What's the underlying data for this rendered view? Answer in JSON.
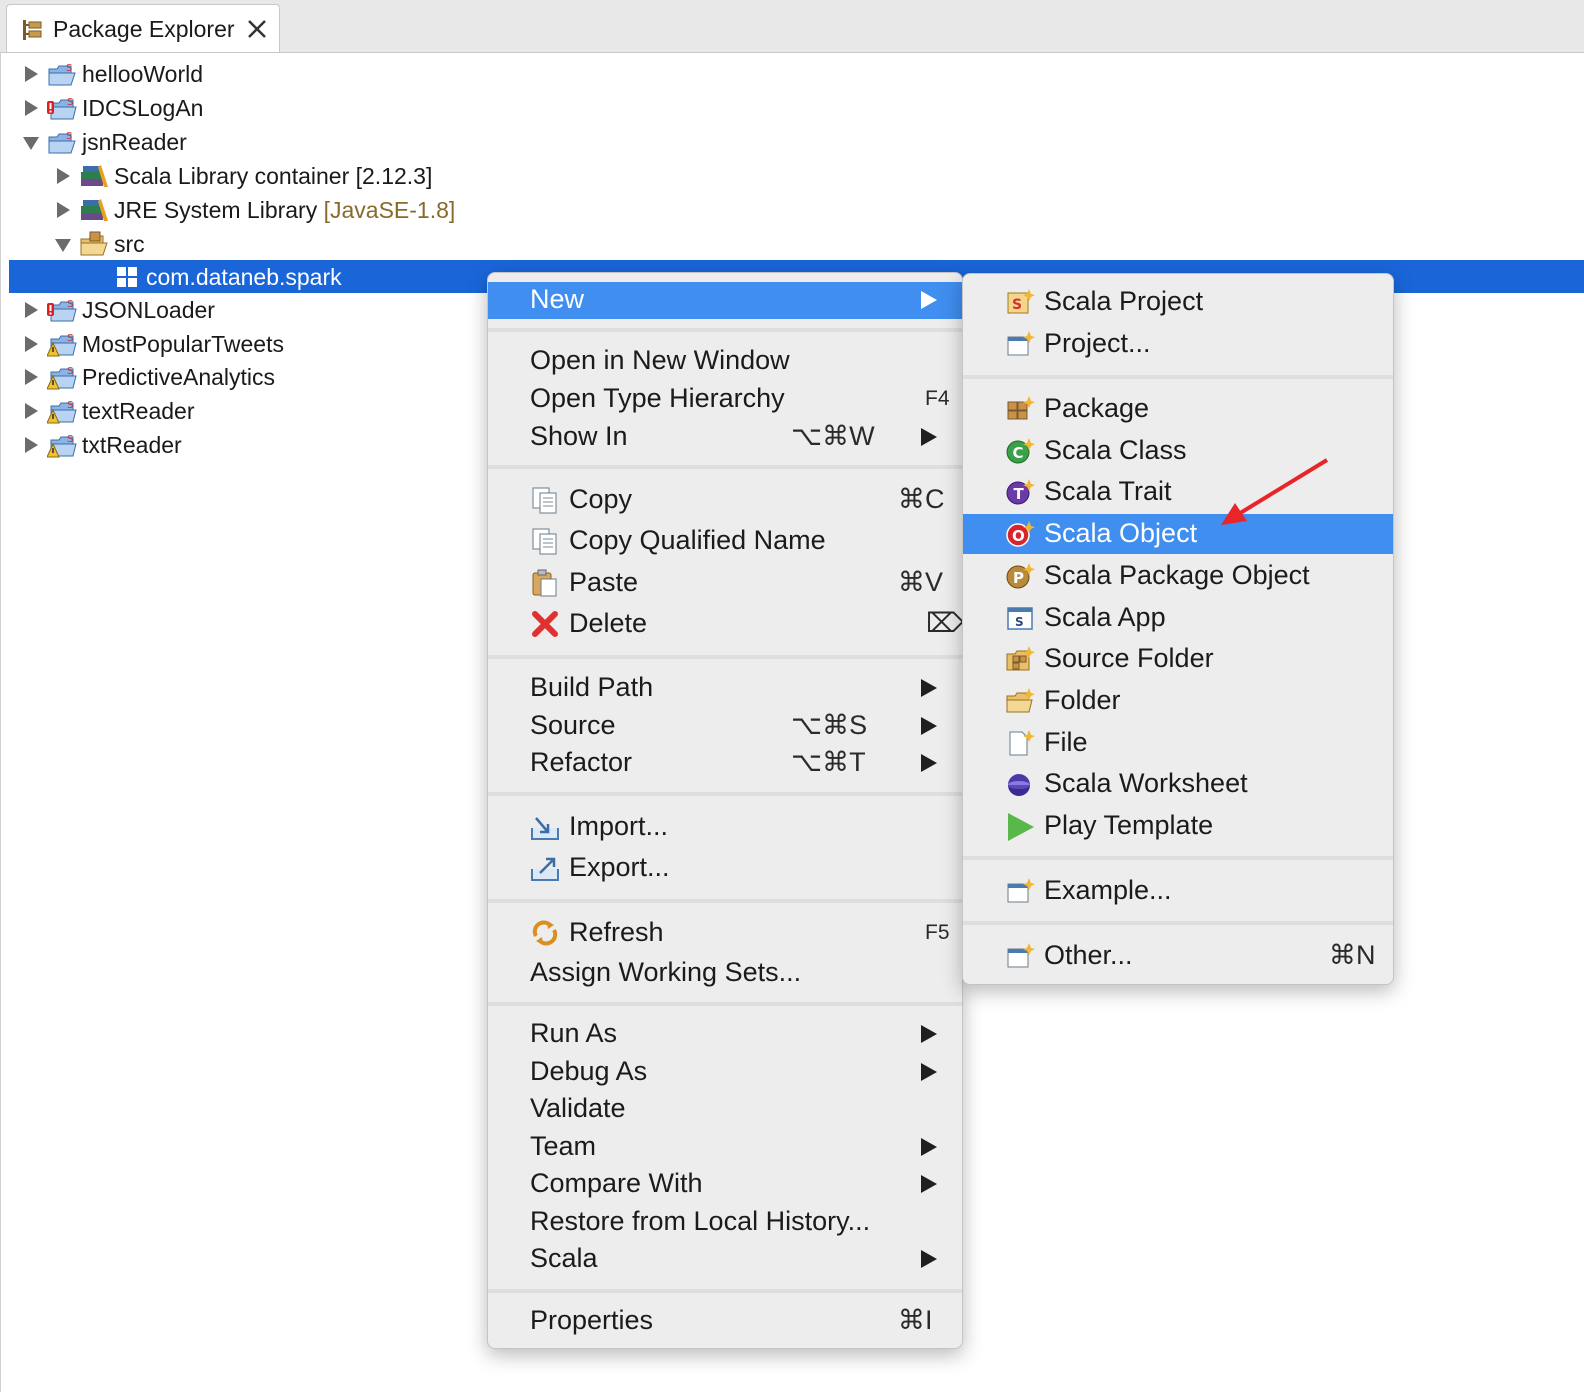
{
  "panel": {
    "title": "Package Explorer"
  },
  "tree": [
    {
      "label": "hellooWorld",
      "state": "closed",
      "icon": "scala-project-icon"
    },
    {
      "label": "IDCSLogAn",
      "state": "closed",
      "icon": "scala-project-error-icon"
    },
    {
      "label": "jsnReader",
      "state": "open",
      "icon": "scala-project-icon"
    },
    {
      "label": "Scala Library container [2.12.3]",
      "state": "closed",
      "icon": "library-icon"
    },
    {
      "label": "JRE System Library",
      "decoration": "[JavaSE-1.8]",
      "state": "closed",
      "icon": "library-icon"
    },
    {
      "label": "src",
      "state": "open",
      "icon": "source-folder-icon"
    },
    {
      "label": "com.dataneb.spark",
      "state": "none",
      "icon": "package-icon",
      "selected": true
    },
    {
      "label": "JSONLoader",
      "state": "closed",
      "icon": "scala-project-error-icon"
    },
    {
      "label": "MostPopularTweets",
      "state": "closed",
      "icon": "scala-project-warning-icon"
    },
    {
      "label": "PredictiveAnalytics",
      "state": "closed",
      "icon": "scala-project-warning-icon"
    },
    {
      "label": "textReader",
      "state": "closed",
      "icon": "scala-project-warning-icon"
    },
    {
      "label": "txtReader",
      "state": "closed",
      "icon": "scala-project-warning-icon"
    }
  ],
  "context_menu": {
    "new": "New",
    "open_new_window": "Open in New Window",
    "open_type_hierarchy": "Open Type Hierarchy",
    "open_type_hierarchy_sc": "F4",
    "show_in": "Show In",
    "show_in_sc": "⌥⌘W",
    "copy": "Copy",
    "copy_sc": "⌘C",
    "copy_qualified": "Copy Qualified Name",
    "paste": "Paste",
    "paste_sc": "⌘V",
    "delete": "Delete",
    "delete_sc": "⌦",
    "build_path": "Build Path",
    "source": "Source",
    "source_sc": "⌥⌘S",
    "refactor": "Refactor",
    "refactor_sc": "⌥⌘T",
    "import": "Import...",
    "export": "Export...",
    "refresh": "Refresh",
    "refresh_sc": "F5",
    "assign_working_sets": "Assign Working Sets...",
    "run_as": "Run As",
    "debug_as": "Debug As",
    "validate": "Validate",
    "team": "Team",
    "compare_with": "Compare With",
    "restore_history": "Restore from Local History...",
    "scala": "Scala",
    "properties": "Properties",
    "properties_sc": "⌘I"
  },
  "new_submenu": {
    "scala_project": "Scala Project",
    "project": "Project...",
    "package": "Package",
    "scala_class": "Scala Class",
    "scala_trait": "Scala Trait",
    "scala_object": "Scala Object",
    "scala_package_object": "Scala Package Object",
    "scala_app": "Scala App",
    "source_folder": "Source Folder",
    "folder": "Folder",
    "file": "File",
    "scala_worksheet": "Scala Worksheet",
    "play_template": "Play Template",
    "example": "Example...",
    "other": "Other...",
    "other_sc": "⌘N"
  },
  "colors": {
    "selection": "#1a66d9",
    "menu_highlight": "#3f8ef0",
    "menu_bg": "#ededed",
    "annotation_arrow": "#e8262a"
  }
}
